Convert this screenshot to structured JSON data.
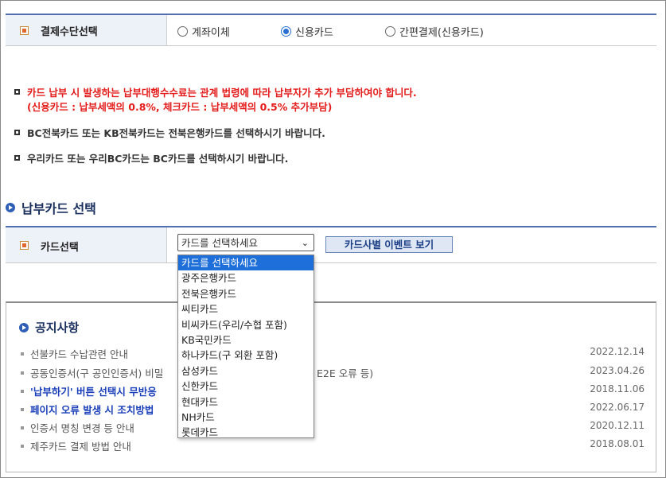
{
  "payment": {
    "label": "결제수단선택",
    "options": [
      {
        "label": "계좌이체",
        "selected": false
      },
      {
        "label": "신용카드",
        "selected": true
      },
      {
        "label": "간편결제(신용카드)",
        "selected": false
      }
    ]
  },
  "notices": {
    "n1_line1": "카드 납부 시 발생하는 납부대행수수료는 관계 법령에 따라 납부자가 추가 부담하여야 합니다.",
    "n1_line2": "(신용카드 : 납부세액의 0.8%, 체크카드 : 납부세액의 0.5% 추가부담)",
    "n2": "BC전북카드 또는 KB전북카드는 전북은행카드를 선택하시기 바랍니다.",
    "n3": "우리카드 또는 우리BC카드는 BC카드를 선택하시기 바랍니다."
  },
  "card_section": {
    "title": "납부카드 선택",
    "label": "카드선택",
    "selected": "카드를 선택하세요",
    "event_button": "카드사별 이벤트 보기",
    "options": [
      "카드를 선택하세요",
      "광주은행카드",
      "전북은행카드",
      "씨티카드",
      "비씨카드(우리/수협 포함)",
      "KB국민카드",
      "하나카드(구 외환 포함)",
      "삼성카드",
      "신한카드",
      "현대카드",
      "NH카드",
      "롯데카드"
    ]
  },
  "board": {
    "title": "공지사항",
    "items": [
      {
        "text": "선불카드 수납관련 안내",
        "date": "2022.12.14",
        "highlight": false
      },
      {
        "text": "공동인증서(구 공인인증서) 비밀",
        "tail": "E2E 오류 등)",
        "date": "2023.04.26",
        "highlight": false
      },
      {
        "text": "'납부하기' 버튼 선택시 무반응",
        "date": "2018.11.06",
        "highlight": true
      },
      {
        "text": "페이지 오류 발생 시 조치방법",
        "date": "2022.06.17",
        "highlight": true
      },
      {
        "text": "인증서 명칭 변경 등 안내",
        "date": "2020.12.11",
        "highlight": false
      },
      {
        "text": "제주카드 결제 방법 안내",
        "date": "2018.08.01",
        "highlight": false
      }
    ]
  },
  "colors": {
    "accent": "#4f6fae",
    "warning": "#e41b1b",
    "selected_option": "#1e6fd9",
    "highlight_link": "#1a3fb8"
  }
}
